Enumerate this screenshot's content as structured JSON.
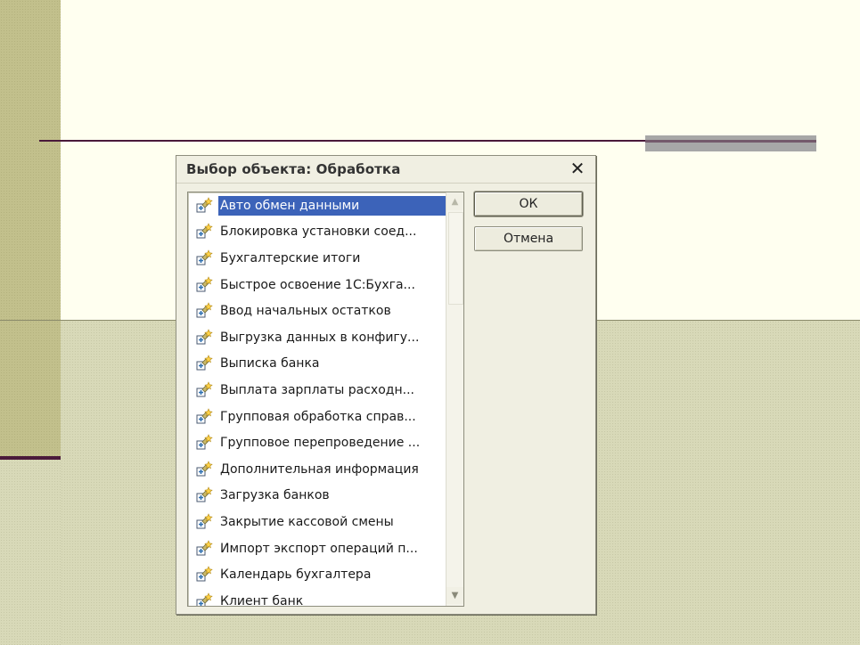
{
  "dialog": {
    "title": "Выбор объекта: Обработка",
    "close_glyph": "✕",
    "ok_label": "ОК",
    "cancel_label": "Отмена"
  },
  "list": {
    "selected_index": 0,
    "item_icon": "processing-object-icon",
    "items": [
      {
        "label": "Авто обмен данными"
      },
      {
        "label": "Блокировка установки соед..."
      },
      {
        "label": "Бухгалтерские итоги"
      },
      {
        "label": "Быстрое освоение 1С:Бухга..."
      },
      {
        "label": "Ввод начальных остатков"
      },
      {
        "label": "Выгрузка данных в конфигу..."
      },
      {
        "label": "Выписка банка"
      },
      {
        "label": "Выплата зарплаты расходн..."
      },
      {
        "label": "Групповая обработка справ..."
      },
      {
        "label": "Групповое перепроведение ..."
      },
      {
        "label": "Дополнительная информация"
      },
      {
        "label": "Загрузка банков"
      },
      {
        "label": "Закрытие кассовой смены"
      },
      {
        "label": "Импорт экспорт операций п..."
      },
      {
        "label": "Календарь бухгалтера"
      },
      {
        "label": "Клиент банк"
      }
    ]
  },
  "colors": {
    "selection": "#3c63b9",
    "slide_accent": "#4a1a3a"
  }
}
